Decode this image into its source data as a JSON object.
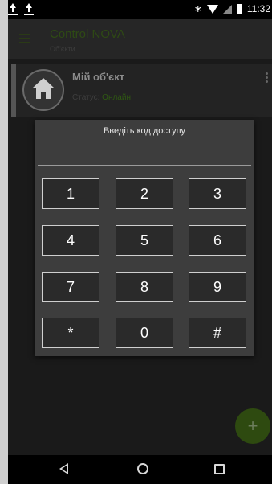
{
  "status_bar": {
    "time": "11:32",
    "icons": [
      "upload-icon",
      "upload-icon",
      "bluetooth-icon",
      "wifi-icon",
      "signal-icon",
      "battery-icon"
    ]
  },
  "app_bar": {
    "title": "Control NOVA",
    "subtitle": "Об'єкти"
  },
  "object_card": {
    "name": "Мій об'єкт",
    "status_label": "Статус:",
    "status_value": "Онлайн"
  },
  "dialog": {
    "title": "Введіть код доступу",
    "code_value": "",
    "keys": [
      "1",
      "2",
      "3",
      "4",
      "5",
      "6",
      "7",
      "8",
      "9",
      "*",
      "0",
      "#"
    ]
  },
  "fab": {
    "label": "+"
  },
  "colors": {
    "accent_green": "#2e4a10",
    "dialog_bg": "#3d3d3d",
    "key_border": "#cfcfcf"
  }
}
